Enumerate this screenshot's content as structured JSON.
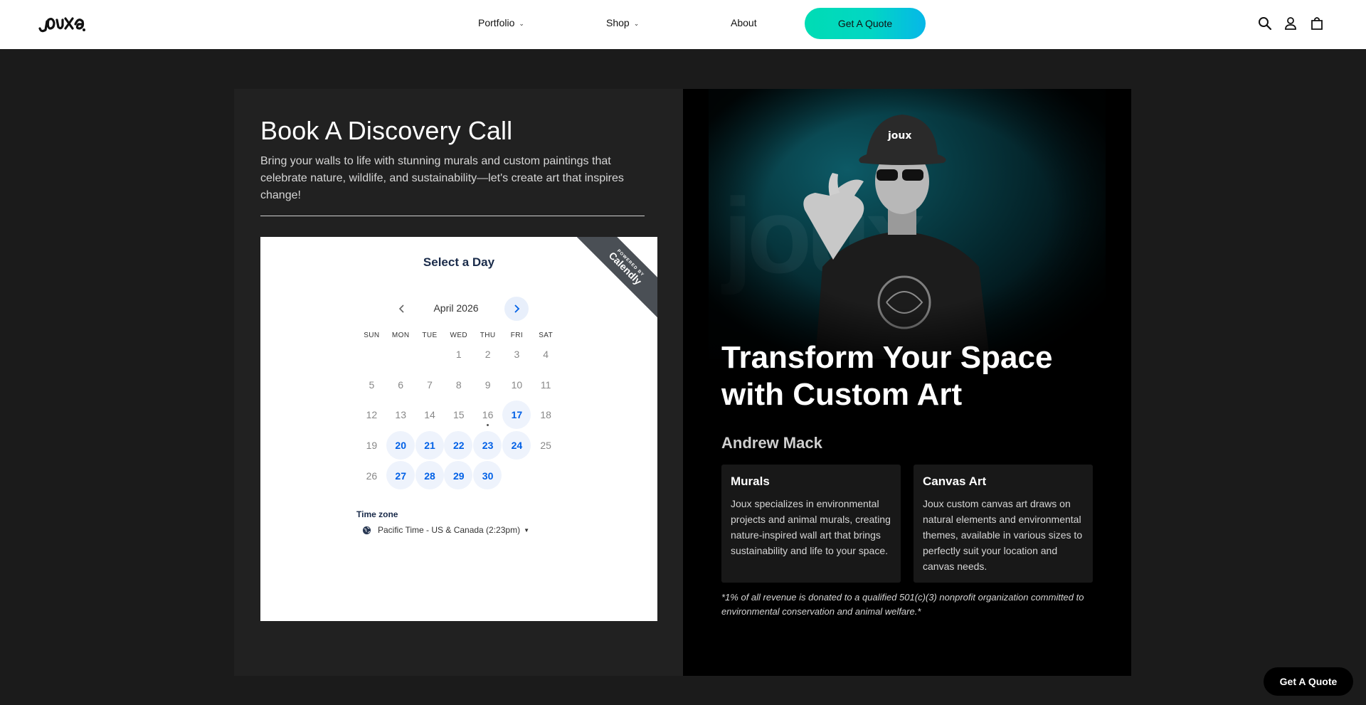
{
  "brand": {
    "logo_text": "JOUX"
  },
  "header": {
    "nav": [
      {
        "label": "Portfolio",
        "has_dropdown": true
      },
      {
        "label": "Shop",
        "has_dropdown": true
      },
      {
        "label": "About",
        "has_dropdown": false
      }
    ],
    "cta_label": "Get A Quote",
    "icons": [
      "search-icon",
      "account-icon",
      "cart-icon"
    ]
  },
  "booking": {
    "title": "Book A Discovery Call",
    "description": "Bring your walls to life with stunning murals and custom paintings that celebrate nature, wildlife, and sustainability—let's create art that inspires change!",
    "calendly": {
      "heading": "Select a Day",
      "ribbon_small": "POWERED BY",
      "ribbon_brand": "Calendly",
      "month": "April 2026",
      "weekdays": [
        "SUN",
        "MON",
        "TUE",
        "WED",
        "THU",
        "FRI",
        "SAT"
      ],
      "weeks": [
        [
          "",
          "",
          "",
          "1",
          "2",
          "3",
          "4"
        ],
        [
          "5",
          "6",
          "7",
          "8",
          "9",
          "10",
          "11"
        ],
        [
          "12",
          "13",
          "14",
          "15",
          "16",
          "17",
          "18"
        ],
        [
          "19",
          "20",
          "21",
          "22",
          "23",
          "24",
          "25"
        ],
        [
          "26",
          "27",
          "28",
          "29",
          "30",
          "",
          ""
        ]
      ],
      "available_days": [
        "17",
        "20",
        "21",
        "22",
        "23",
        "24",
        "27",
        "28",
        "29",
        "30"
      ],
      "today": "16",
      "timezone_label": "Time zone",
      "timezone_value": "Pacific Time - US & Canada (2:23pm)"
    }
  },
  "promo": {
    "headline": "Transform Your Space with Custom Art",
    "artist_name": "Andrew Mack",
    "cards": [
      {
        "title": "Murals",
        "text": "Joux specializes in environmental projects and animal murals, creating nature-inspired wall art that brings sustainability and life to your space."
      },
      {
        "title": "Canvas Art",
        "text": "Joux custom canvas art draws on natural elements and environmental themes, available in various sizes to perfectly suit your location and canvas needs."
      }
    ],
    "note": "*1% of all revenue is donated to a qualified 501(c)(3) nonprofit organization committed to environmental conservation and animal welfare.*"
  },
  "floating_cta": "Get A Quote",
  "colors": {
    "accent_start": "#00dcb4",
    "accent_end": "#06b7e8",
    "calendly_blue": "#0060e6"
  }
}
